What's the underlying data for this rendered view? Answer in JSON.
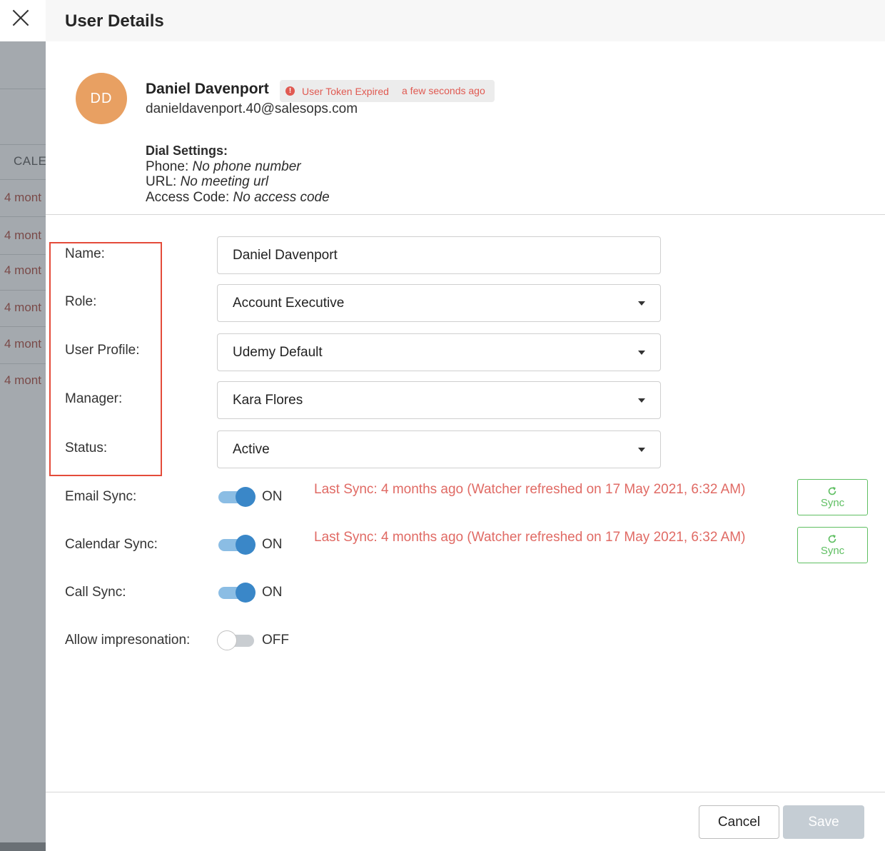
{
  "background": {
    "calendar_header": "CALE",
    "rows": [
      "4 mont",
      "4 mont",
      "4 mont",
      "4 mont",
      "4 mont",
      "4 mont"
    ]
  },
  "panel": {
    "title": "User Details",
    "close_icon": "close-icon"
  },
  "user": {
    "initials": "DD",
    "name": "Daniel Davenport",
    "email": "danieldavenport.40@salesops.com",
    "token_status": "User Token Expired",
    "token_time": "a few seconds ago",
    "warning_icon": "!"
  },
  "dial": {
    "title": "Dial Settings:",
    "phone_label": "Phone:",
    "phone_value": "No phone number",
    "url_label": "URL:",
    "url_value": "No meeting url",
    "access_label": "Access Code:",
    "access_value": "No access code"
  },
  "form": {
    "name": {
      "label": "Name:",
      "value": "Daniel Davenport"
    },
    "role": {
      "label": "Role:",
      "value": "Account Executive"
    },
    "profile": {
      "label": "User Profile:",
      "value": "Udemy Default"
    },
    "manager": {
      "label": "Manager:",
      "value": "Kara Flores"
    },
    "status": {
      "label": "Status:",
      "value": "Active"
    }
  },
  "toggles": {
    "email": {
      "label": "Email Sync:",
      "state": "ON",
      "message": "Last Sync: 4 months ago (Watcher refreshed on 17 May 2021, 6:32 AM)",
      "sync_button": "Sync"
    },
    "calendar": {
      "label": "Calendar Sync:",
      "state": "ON",
      "message": "Last Sync: 4 months ago (Watcher refreshed on 17 May 2021, 6:32 AM)",
      "sync_button": "Sync"
    },
    "call": {
      "label": "Call Sync:",
      "state": "ON"
    },
    "impersonation": {
      "label": "Allow impresonation:",
      "state": "OFF"
    }
  },
  "footer": {
    "cancel": "Cancel",
    "save": "Save"
  },
  "colors": {
    "accent_blue": "#3a87c8",
    "error_red": "#e05a52",
    "sync_green": "#5fbf62",
    "highlight_red": "#e44b3a",
    "avatar_orange": "#e8a062"
  }
}
